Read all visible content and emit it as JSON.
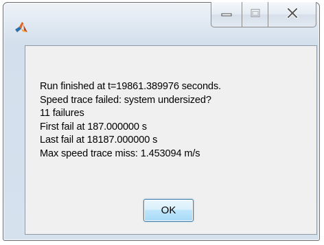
{
  "window": {
    "app_icon": "matlab-logo-icon",
    "caption_buttons": {
      "minimize_icon": "minimize-icon",
      "maximize_icon": "maximize-icon",
      "close_icon": "close-icon"
    }
  },
  "dialog": {
    "message_lines": [
      "Run finished at t=19861.389976 seconds.",
      "Speed trace failed: system undersized?",
      "11 failures",
      "First fail at 187.000000 s",
      "Last fail at 18187.000000 s",
      "Max speed trace miss: 1.453094 m/s"
    ],
    "ok_label": "OK"
  },
  "colors": {
    "client_background": "#f0f0f0",
    "frame_background": "#d6e1ee",
    "ok_border": "#3c7fb1",
    "logo_orange": "#e1691f",
    "logo_blue": "#2d6fa8"
  }
}
